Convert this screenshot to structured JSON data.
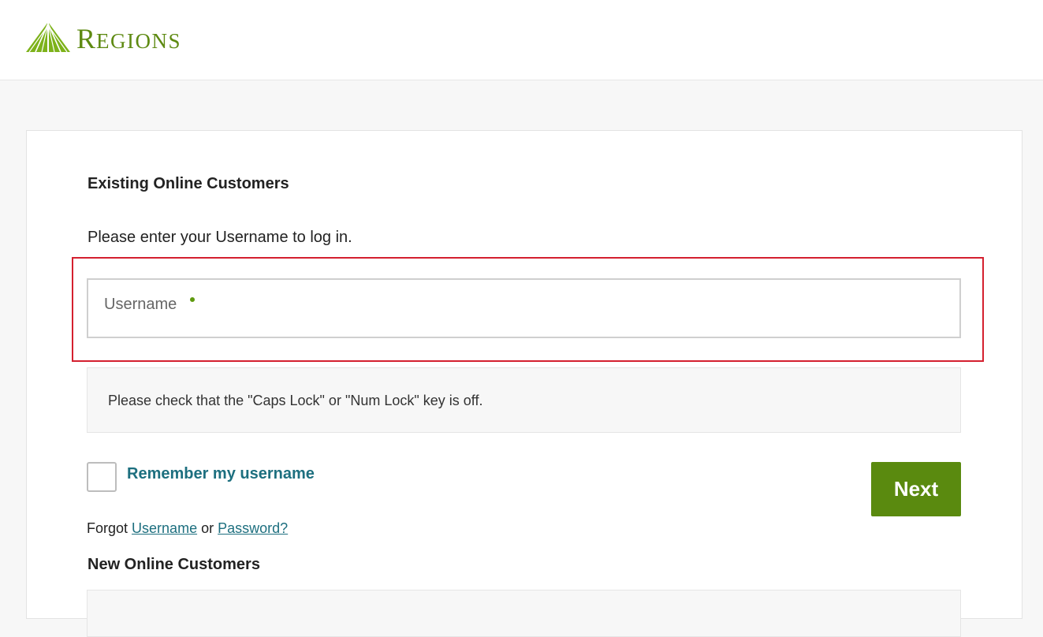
{
  "brand": {
    "name_initial": "R",
    "name_rest": "EGIONS",
    "color": "#5e8a12"
  },
  "login": {
    "existing_title": "Existing Online Customers",
    "intro_text": "Please enter your Username to log in.",
    "username_placeholder": "Username",
    "caps_notice": "Please check that the \"Caps Lock\" or \"Num Lock\" key is off.",
    "remember_label": "Remember my username",
    "next_label": "Next",
    "forgot_prefix": "Forgot",
    "forgot_username": "Username",
    "forgot_or": "or",
    "forgot_password": "Password?",
    "new_title": "New Online Customers"
  },
  "colors": {
    "highlight_border": "#d4202f",
    "button_green": "#5a8a0f",
    "link_teal": "#1d6f7f",
    "required_dot": "#5e9a0e"
  }
}
